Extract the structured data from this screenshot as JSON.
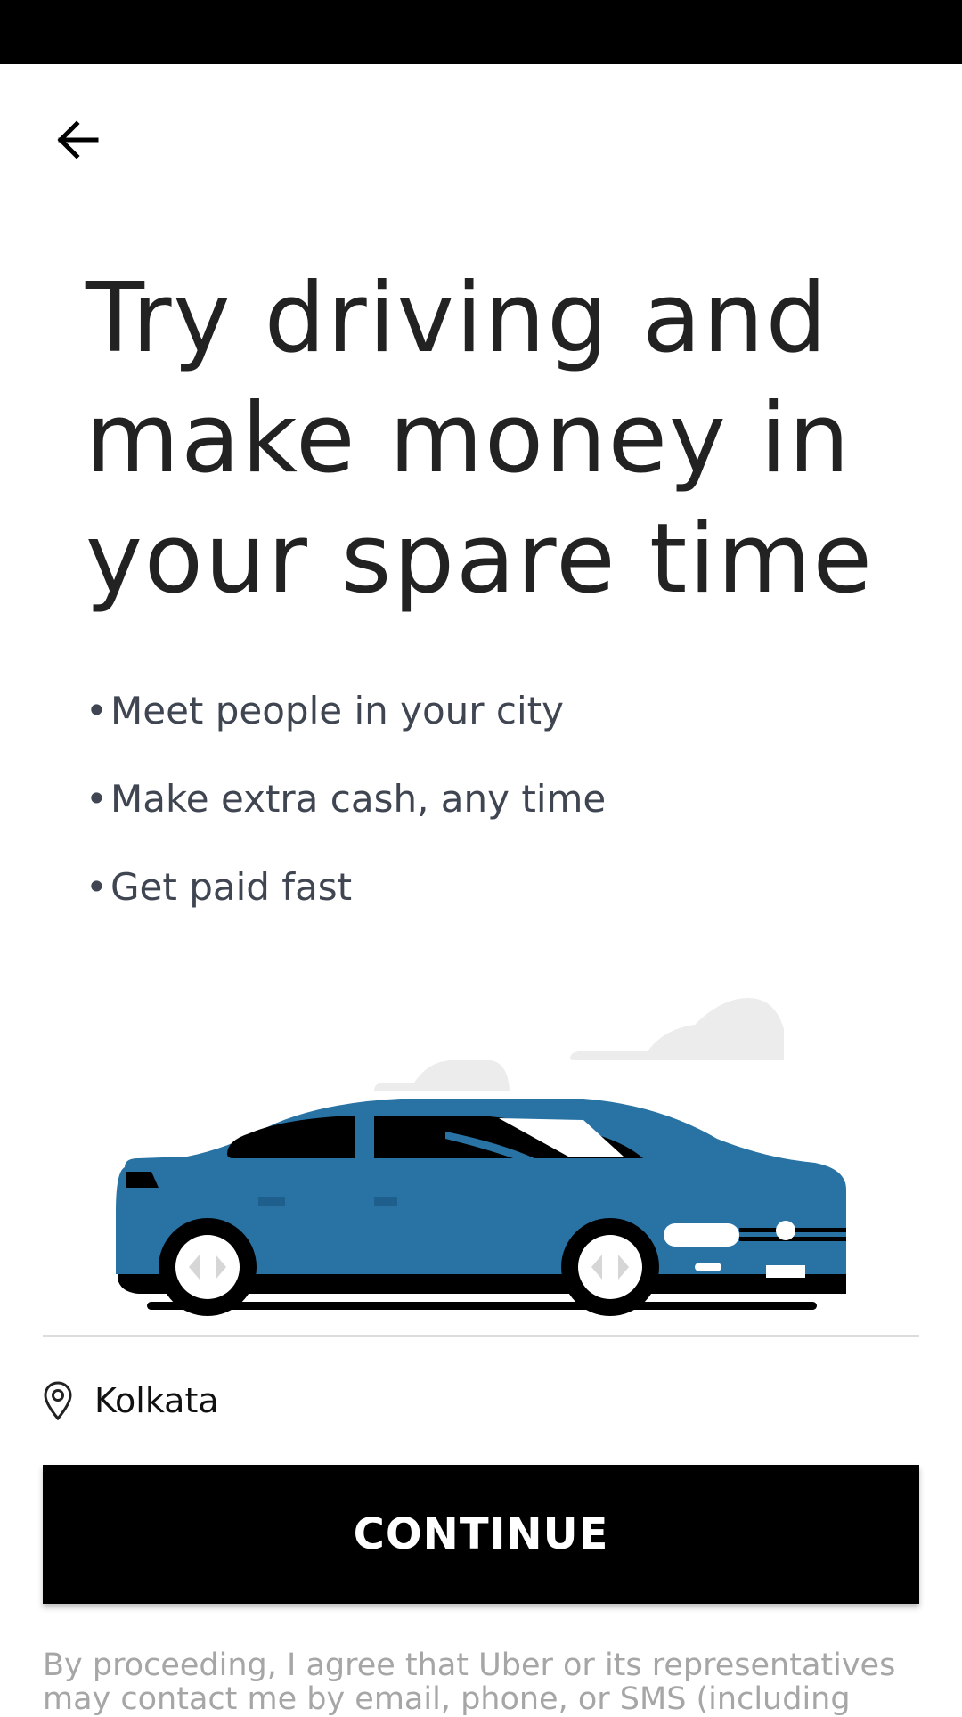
{
  "status_bar": {},
  "header": {
    "back_icon": "arrow-left-icon"
  },
  "headline": {
    "line1": "Try driving and",
    "line2": "make money in",
    "line3": "your spare time"
  },
  "bullets": [
    "Meet people in your city",
    "Make extra cash, any time",
    "Get paid fast"
  ],
  "bullet_char": "•",
  "illustration": {
    "subject": "car-illustration",
    "car_color": "#2873a4"
  },
  "location": {
    "icon": "location-pin-icon",
    "city": "Kolkata"
  },
  "continue_label": "CONTINUE",
  "legal_text": "By proceeding, I agree that Uber or its representatives may contact me by email, phone, or SMS (including"
}
